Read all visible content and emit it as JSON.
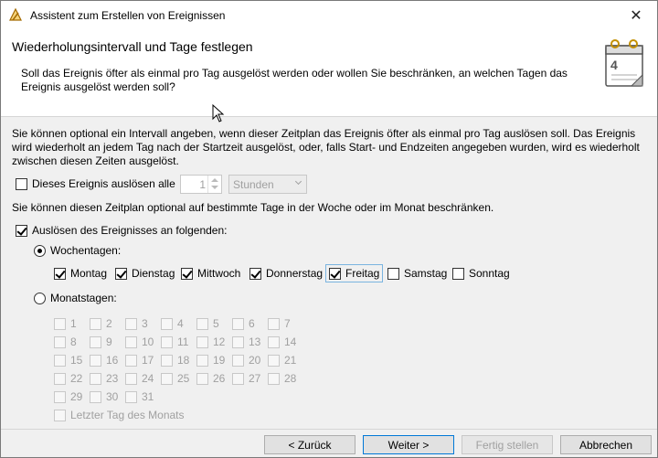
{
  "window": {
    "title": "Assistent zum Erstellen von Ereignissen"
  },
  "header": {
    "title": "Wiederholungsintervall und Tage festlegen",
    "description": "Soll das Ereignis öfter als einmal pro Tag ausgelöst werden oder wollen Sie beschränken, an welchen Tagen das Ereignis ausgelöst werden soll?"
  },
  "body": {
    "intro": "Sie können optional ein Intervall angeben, wenn dieser Zeitplan das Ereignis öfter als einmal pro Tag auslösen soll. Das Ereignis wird wiederholt an jedem Tag nach der Startzeit ausgelöst, oder, falls Start- und Endzeiten angegeben wurden, wird es wiederholt zwischen diesen Zeiten ausgelöst.",
    "repeat_checkbox_label": "Dieses Ereignis auslösen alle",
    "repeat_checked": false,
    "interval_value": "1",
    "interval_unit": "Stunden",
    "restrict_text": "Sie können diesen Zeitplan optional auf bestimmte Tage in der Woche oder im Monat beschränken.",
    "trigger_label": "Auslösen des Ereignisses an folgenden:",
    "trigger_checked": true,
    "weekdays_radio_label": "Wochentagen:",
    "weekdays_selected": true,
    "weekdays": [
      {
        "label": "Montag",
        "checked": true
      },
      {
        "label": "Dienstag",
        "checked": true
      },
      {
        "label": "Mittwoch",
        "checked": true
      },
      {
        "label": "Donnerstag",
        "checked": true
      },
      {
        "label": "Freitag",
        "checked": true
      },
      {
        "label": "Samstag",
        "checked": false
      },
      {
        "label": "Sonntag",
        "checked": false
      }
    ],
    "monthdays_radio_label": "Monatstagen:",
    "monthdays_selected": false,
    "monthdays": [
      "1",
      "2",
      "3",
      "4",
      "5",
      "6",
      "7",
      "8",
      "9",
      "10",
      "11",
      "12",
      "13",
      "14",
      "15",
      "16",
      "17",
      "18",
      "19",
      "20",
      "21",
      "22",
      "23",
      "24",
      "25",
      "26",
      "27",
      "28",
      "29",
      "30",
      "31"
    ],
    "last_day_label": "Letzter Tag des Monats"
  },
  "footer": {
    "back": "< Zurück",
    "next": "Weiter >",
    "finish": "Fertig stellen",
    "cancel": "Abbrechen"
  }
}
